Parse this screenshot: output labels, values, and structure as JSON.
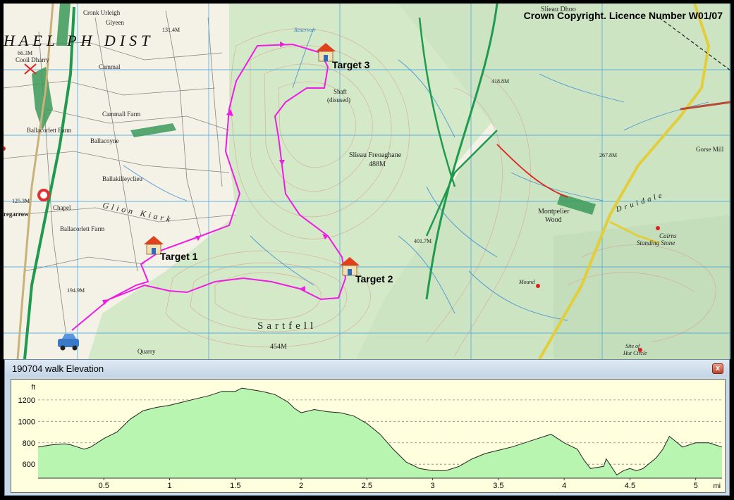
{
  "map": {
    "copyright": "Crown Copyright. Licence Number W01/07",
    "targets": [
      {
        "name": "target-1",
        "label": "Target 1"
      },
      {
        "name": "target-2",
        "label": "Target 2"
      },
      {
        "name": "target-3",
        "label": "Target 3"
      }
    ],
    "places": [
      {
        "text": "HAEL PH DIST"
      },
      {
        "text": "Cronk Urleigh"
      },
      {
        "text": "Glyeen"
      },
      {
        "text": "131.4M"
      },
      {
        "text": "Reservoir"
      },
      {
        "text": "Cooil Dharry"
      },
      {
        "text": "66.3M"
      },
      {
        "text": "Cammal"
      },
      {
        "text": "Cammall Farm"
      },
      {
        "text": "Ballacorlett Farm"
      },
      {
        "text": "Ballacoyne"
      },
      {
        "text": "Ballakilleyclieu"
      },
      {
        "text": "125.3M"
      },
      {
        "text": "Chapel"
      },
      {
        "text": "regarrow"
      },
      {
        "text": "Ballacorlett Farm"
      },
      {
        "text": "Glion Kiark"
      },
      {
        "text": "194.9M"
      },
      {
        "text": "Sartfell"
      },
      {
        "text": "454M"
      },
      {
        "text": "Quarry"
      },
      {
        "text": "Shaft"
      },
      {
        "text": "(disused)"
      },
      {
        "text": "Slieau Freoaghane"
      },
      {
        "text": "488M"
      },
      {
        "text": "401.7M"
      },
      {
        "text": "418.8M"
      },
      {
        "text": "Slieau Dhoo"
      },
      {
        "text": "267.8M"
      },
      {
        "text": "Gorse Mill"
      },
      {
        "text": "Druidale"
      },
      {
        "text": "Montpelier"
      },
      {
        "text": "Wood"
      },
      {
        "text": "Cairns"
      },
      {
        "text": "Standing Stone"
      },
      {
        "text": "Mound"
      },
      {
        "text": "Site of"
      },
      {
        "text": "Hut Circle"
      }
    ]
  },
  "elevation_panel": {
    "title": "190704 walk Elevation",
    "close_label": "x"
  },
  "chart_data": {
    "type": "area",
    "title": "",
    "xlabel": "mi",
    "ylabel": "ft",
    "xlim": [
      0,
      5.2
    ],
    "ylim": [
      470,
      1350
    ],
    "x_ticks": [
      0.5,
      1,
      1.5,
      2,
      2.5,
      3,
      3.5,
      4,
      4.5,
      5
    ],
    "y_ticks": [
      600,
      800,
      1000,
      1200
    ],
    "grid": true,
    "colors": {
      "fill": "#b7f5b0",
      "line": "#222222",
      "grid": "#888888"
    },
    "series": [
      {
        "x": [
          0,
          0.1,
          0.2,
          0.25,
          0.3,
          0.35,
          0.4,
          0.45,
          0.5,
          0.6,
          0.7,
          0.8,
          0.9,
          1.0,
          1.1,
          1.2,
          1.3,
          1.4,
          1.5,
          1.55,
          1.6,
          1.7,
          1.8,
          1.9,
          1.95,
          2.0,
          2.1,
          2.2,
          2.3,
          2.4,
          2.5,
          2.6,
          2.7,
          2.8,
          2.9,
          3.0,
          3.1,
          3.2,
          3.3,
          3.4,
          3.5,
          3.6,
          3.7,
          3.8,
          3.9,
          4.0,
          4.1,
          4.15,
          4.2,
          4.3,
          4.32,
          4.4,
          4.45,
          4.5,
          4.55,
          4.6,
          4.7,
          4.75,
          4.8,
          4.9,
          5.0,
          5.1,
          5.2
        ],
        "y": [
          760,
          780,
          790,
          780,
          760,
          740,
          760,
          800,
          840,
          900,
          1020,
          1100,
          1130,
          1150,
          1180,
          1210,
          1240,
          1280,
          1280,
          1310,
          1300,
          1280,
          1250,
          1180,
          1120,
          1080,
          1110,
          1090,
          1080,
          1050,
          980,
          880,
          740,
          620,
          560,
          540,
          540,
          580,
          650,
          700,
          730,
          760,
          800,
          840,
          880,
          800,
          740,
          640,
          560,
          580,
          650,
          500,
          540,
          560,
          540,
          560,
          660,
          740,
          860,
          760,
          800,
          800,
          760
        ]
      }
    ]
  }
}
